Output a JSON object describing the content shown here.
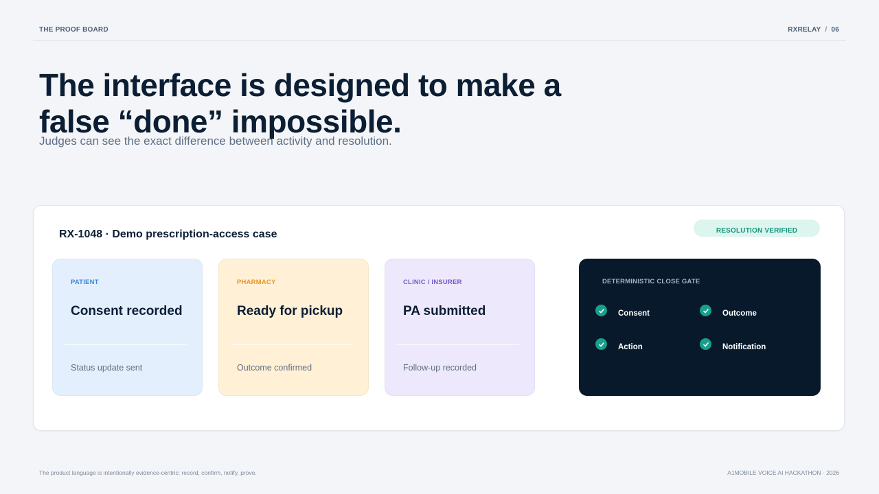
{
  "header": {
    "section_label": "THE PROOF BOARD",
    "brand": "RXRELAY",
    "separator": "/",
    "page_number": "06"
  },
  "headline": {
    "line1": "The interface is designed to make a",
    "line2": "false “done” impossible."
  },
  "subhead": "Judges can see the exact difference between activity and resolution.",
  "case": {
    "title": "RX-1048 · Demo prescription-access case",
    "badge": "RESOLUTION VERIFIED",
    "cards": [
      {
        "role": "PATIENT",
        "status": "Consent recorded",
        "note": "Status update sent",
        "accent": "#3b87dc",
        "bg": "#e3effd"
      },
      {
        "role": "PHARMACY",
        "status": "Ready for pickup",
        "note": "Outcome confirmed",
        "accent": "#e8972a",
        "bg": "#fff0d6"
      },
      {
        "role": "CLINIC / INSURER",
        "status": "PA submitted",
        "note": "Follow-up recorded",
        "accent": "#7a5bc9",
        "bg": "#eee8fd"
      }
    ],
    "gate": {
      "title": "DETERMINISTIC CLOSE GATE",
      "items": [
        {
          "label": "Consent",
          "icon": "check-circle-icon"
        },
        {
          "label": "Outcome",
          "icon": "check-circle-icon"
        },
        {
          "label": "Action",
          "icon": "check-circle-icon"
        },
        {
          "label": "Notification",
          "icon": "check-circle-icon"
        }
      ]
    }
  },
  "footer": {
    "left": "The product language is intentionally evidence-centric: record, confirm, notify, prove.",
    "right": "A1MOBILE VOICE AI HACKATHON · 2026"
  },
  "colors": {
    "background": "#f3f5f8",
    "ink": "#0c1e33",
    "gate_bg": "#07192b",
    "verified_green": "#16957e"
  }
}
